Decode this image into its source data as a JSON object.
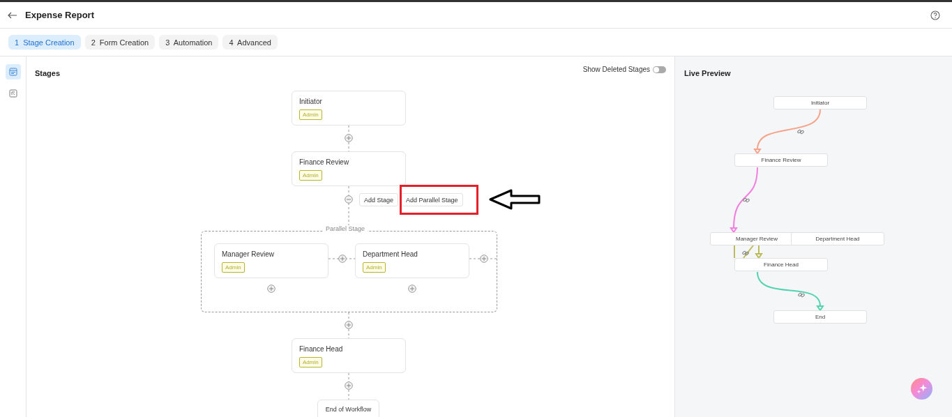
{
  "header": {
    "title": "Expense Report"
  },
  "steps": [
    {
      "number": "1",
      "label": "Stage Creation",
      "selected": true
    },
    {
      "number": "2",
      "label": "Form Creation",
      "selected": false
    },
    {
      "number": "3",
      "label": "Automation",
      "selected": false
    },
    {
      "number": "4",
      "label": "Advanced",
      "selected": false
    }
  ],
  "rail": [
    {
      "kind": "stages",
      "selected": true
    },
    {
      "kind": "form",
      "selected": false
    }
  ],
  "stages_panel": {
    "title": "Stages",
    "show_deleted": {
      "label": "Show Deleted Stages",
      "on": false
    },
    "stages": [
      {
        "name": "Initiator",
        "role": "Admin"
      },
      {
        "name": "Finance Review",
        "role": "Admin"
      }
    ],
    "actions": {
      "add_stage": "Add Stage",
      "add_parallel": "Add Parallel Stage"
    },
    "parallel": {
      "label": "Parallel Stage",
      "stages": [
        {
          "name": "Manager Review",
          "role": "Admin"
        },
        {
          "name": "Department Head",
          "role": "Admin"
        }
      ]
    },
    "after": [
      {
        "name": "Finance Head",
        "role": "Admin"
      }
    ],
    "end_label": "End of Workflow"
  },
  "preview": {
    "title": "Live Preview",
    "nodes": [
      {
        "label": "Initiator"
      },
      {
        "label": "Finance Review"
      },
      {
        "label": "Manager Review"
      },
      {
        "label": "Department Head"
      },
      {
        "label": "Finance Head"
      },
      {
        "label": "End"
      }
    ],
    "edges": [
      {
        "color": "#f7a38c"
      },
      {
        "color": "#f47de0"
      },
      {
        "color": "#bcbc5c"
      },
      {
        "color": "#52d4ae"
      }
    ]
  }
}
